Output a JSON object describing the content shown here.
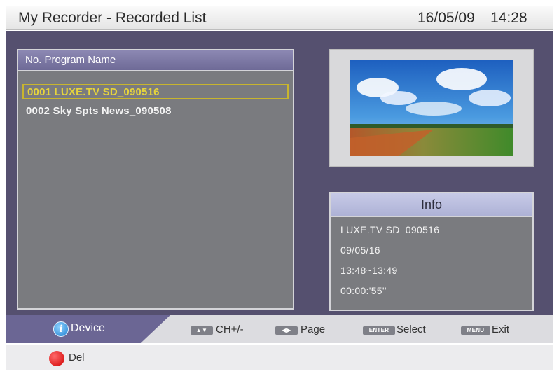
{
  "header": {
    "title": "My Recorder - Recorded List",
    "date": "16/05/09",
    "time": "14:28"
  },
  "list": {
    "header_label": "No. Program Name",
    "items": [
      {
        "label": "0001 LUXE.TV SD_090516",
        "selected": true
      },
      {
        "label": "0002 Sky  Spts  News_090508",
        "selected": false
      }
    ]
  },
  "preview": {
    "icon": "landscape-thumbnail"
  },
  "info": {
    "title": "Info",
    "program": "LUXE.TV SD_090516",
    "date": "09/05/16",
    "time_range": "13:48~13:49",
    "duration": "00:00:'55''"
  },
  "bottom_bar": {
    "device_label": "Device",
    "device_icon_glyph": "i",
    "ch_key": "▲▼",
    "ch_label": "CH+/-",
    "page_key": "◀▶",
    "page_label": "Page",
    "enter_key": "ENTER",
    "select_label": "Select",
    "menu_key": "MENU",
    "exit_label": "Exit"
  },
  "footer": {
    "del_label": "Del"
  },
  "colors": {
    "panel_bg": "#55506f",
    "selected_text": "#e6d43c",
    "header_purple": "#6e6a97",
    "del_red": "#d00000"
  }
}
